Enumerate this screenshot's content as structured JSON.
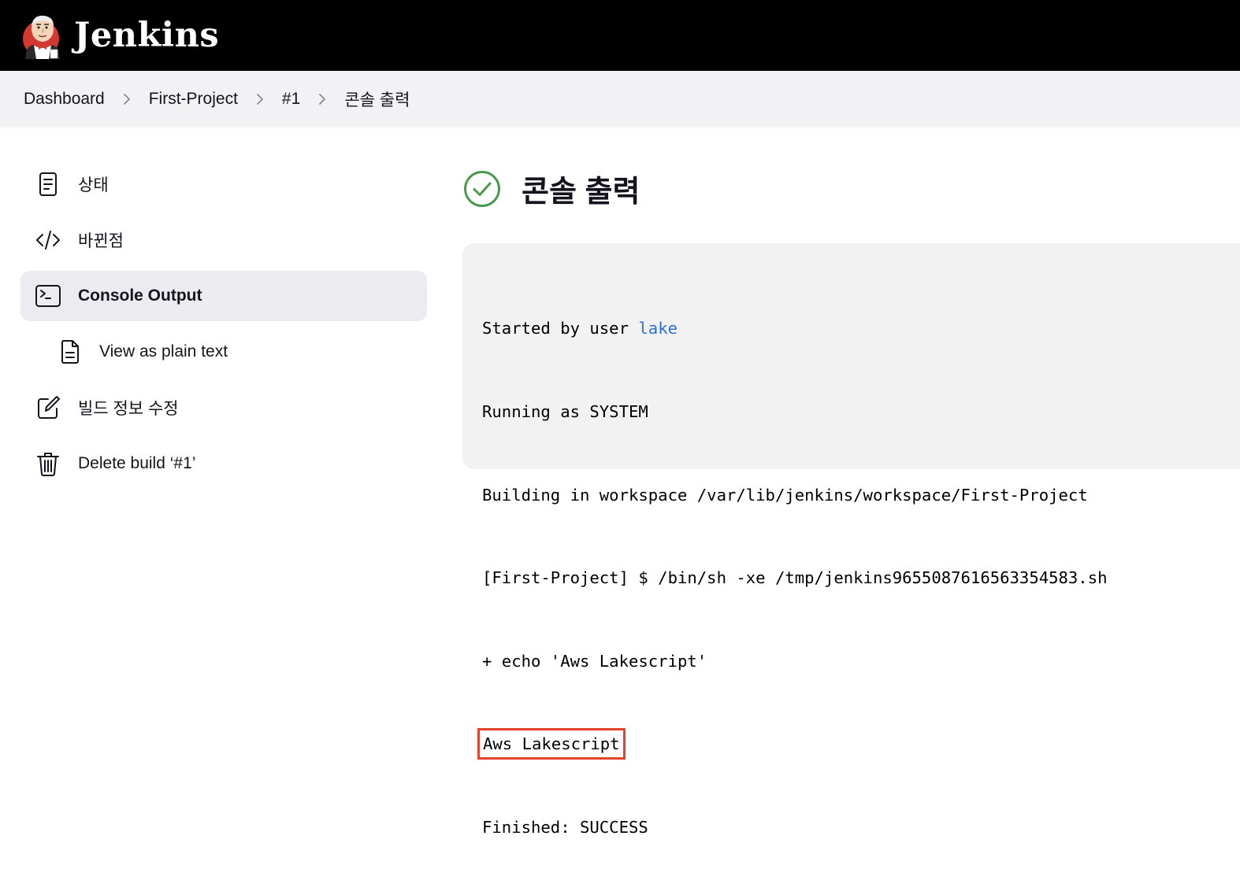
{
  "header": {
    "brand": "Jenkins",
    "logo_icon": "jenkins-butler-icon"
  },
  "breadcrumb": {
    "items": [
      "Dashboard",
      "First-Project",
      "#1",
      "콘솔 출력"
    ],
    "separator_icon": "chevron-right-icon"
  },
  "sidebar": {
    "items": [
      {
        "label": "상태",
        "icon": "document-icon",
        "active": false
      },
      {
        "label": "바뀐점",
        "icon": "code-icon",
        "active": false
      },
      {
        "label": "Console Output",
        "icon": "terminal-icon",
        "active": true
      },
      {
        "label": "View as plain text",
        "icon": "file-text-icon",
        "active": false
      },
      {
        "label": "빌드 정보 수정",
        "icon": "edit-icon",
        "active": false
      },
      {
        "label": "Delete build ‘#1’",
        "icon": "trash-icon",
        "active": false
      }
    ]
  },
  "main": {
    "title": "콘솔 출력",
    "status_icon": "success-check-icon",
    "status_color": "#4a9a4e"
  },
  "console": {
    "started_prefix": "Started by user ",
    "user": "lake",
    "lines": [
      "Running as SYSTEM",
      "Building in workspace /var/lib/jenkins/workspace/First-Project",
      "[First-Project] $ /bin/sh -xe /tmp/jenkins9655087616563354583.sh",
      "+ echo 'Aws Lakescript'",
      "Aws Lakescript",
      "Finished: SUCCESS"
    ],
    "highlight_color": "#e0442a"
  },
  "colors": {
    "header_bg": "#000000",
    "breadcrumb_bg": "#f2f2f4",
    "console_bg": "#f2f2f2",
    "link": "#2f6fde"
  }
}
